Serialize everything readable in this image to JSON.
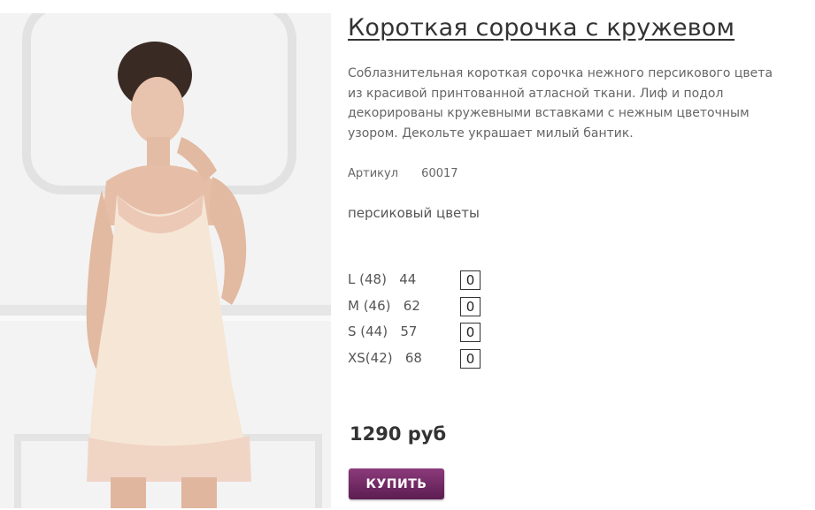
{
  "product": {
    "title": "Короткая сорочка с кружевом",
    "description": "Соблазнительная короткая сорочка нежного персикового цвета из красивой принтованной атласной ткани. Лиф и подол декорированы кружевными вставками с нежным цветочным узором. Декольте украшает милый бантик.",
    "sku_label": "Артикул",
    "sku_value": "60017",
    "color": "персиковый цветы",
    "sizes": [
      {
        "label": "L (48)   44",
        "qty": "0"
      },
      {
        "label": "M (46)   62",
        "qty": "0"
      },
      {
        "label": "S (44)   57",
        "qty": "0"
      },
      {
        "label": "XS(42)   68",
        "qty": "0"
      }
    ],
    "price": "1290 руб",
    "buy_label": "КУПИТЬ"
  },
  "colors": {
    "button_top": "#8b3a7a",
    "button_bottom": "#5c1d52",
    "title": "#333333",
    "text": "#666666"
  }
}
